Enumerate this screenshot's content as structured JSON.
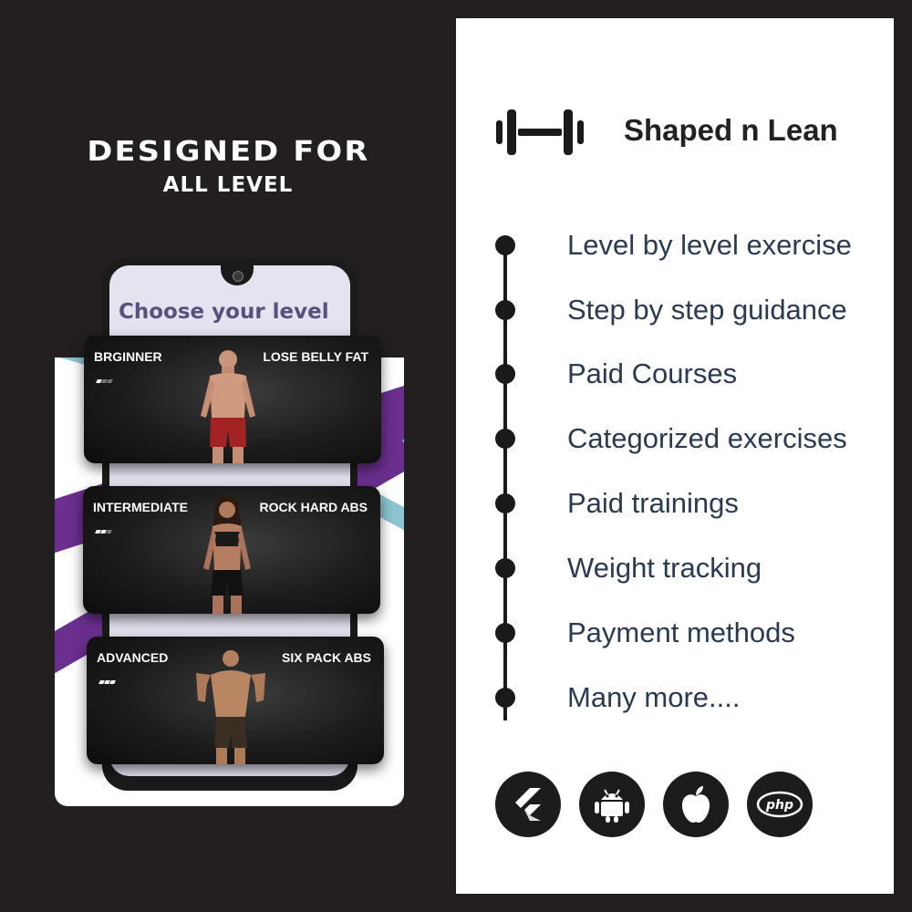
{
  "promo": {
    "headline_line1": "DESIGNED FOR",
    "headline_line2": "ALL LEVEL"
  },
  "phone": {
    "title": "Choose your level",
    "levels": [
      {
        "name": "BRGINNER",
        "goal": "LOSE BELLY FAT",
        "intensity": 1
      },
      {
        "name": "INTERMEDIATE",
        "goal": "ROCK HARD ABS",
        "intensity": 2
      },
      {
        "name": "ADVANCED",
        "goal": "SIX PACK ABS",
        "intensity": 3
      }
    ]
  },
  "panel": {
    "brand_name": "Shaped n Lean",
    "brand_icon": "dumbbell-icon",
    "features": [
      "Level by level exercise",
      "Step by step guidance",
      "Paid Courses",
      "Categorized exercises",
      "Paid trainings",
      "Weight tracking",
      "Payment methods",
      "Many more...."
    ],
    "tech_icons": [
      "flutter-icon",
      "android-icon",
      "apple-icon",
      "php-icon"
    ],
    "tech_php_label": "php"
  },
  "colors": {
    "background": "#231f20",
    "accent_purple": "#6b2f8f",
    "accent_teal": "#8cc5cf",
    "phone_title": "#56527f",
    "feature_text": "#2a3a52"
  }
}
